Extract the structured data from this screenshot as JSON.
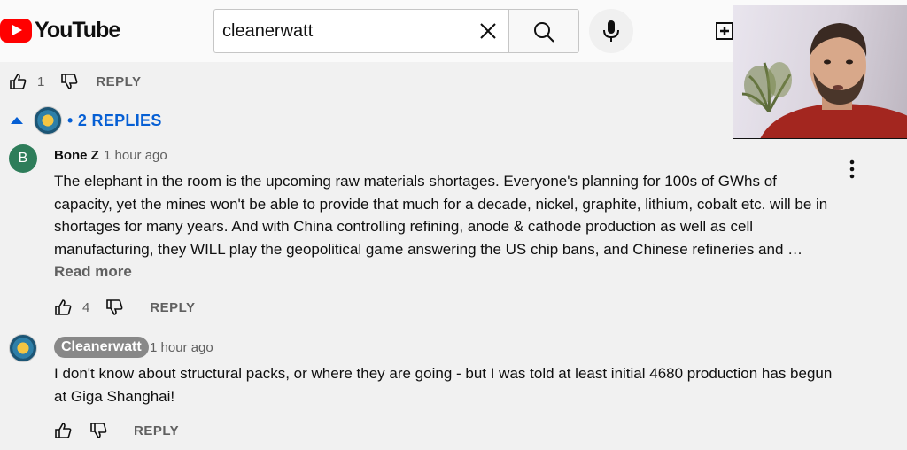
{
  "header": {
    "logo_text": "YouTube",
    "search": {
      "value": "cleanerwatt"
    }
  },
  "thread": {
    "parent_likes": "1",
    "reply_label": "REPLY",
    "replies_toggle": "• 2 REPLIES"
  },
  "comments": [
    {
      "avatar_letter": "B",
      "author": "Bone Z",
      "time": "1 hour ago",
      "text": "The elephant in the room is the upcoming raw materials shortages. Everyone's planning for 100s of GWhs of capacity, yet the mines won't be able to provide that much for a decade, nickel, graphite, lithium, cobalt etc. will be in shortages for many years. And with China controlling refining, anode & cathode production as well as cell manufacturing, they WILL play the geopolitical game answering the US chip bans, and Chinese refineries and …",
      "read_more": "Read more",
      "likes": "4",
      "reply_label": "REPLY"
    },
    {
      "author": "Cleanerwatt",
      "time": "1 hour ago",
      "text": "I don't know about structural packs, or where they are going - but I was told at least initial 4680 production has begun at Giga Shanghai!",
      "reply_label": "REPLY"
    }
  ],
  "colors": {
    "accent_blue": "#065fd4",
    "brand_red": "#ff0000",
    "secondary_text": "#606060"
  }
}
